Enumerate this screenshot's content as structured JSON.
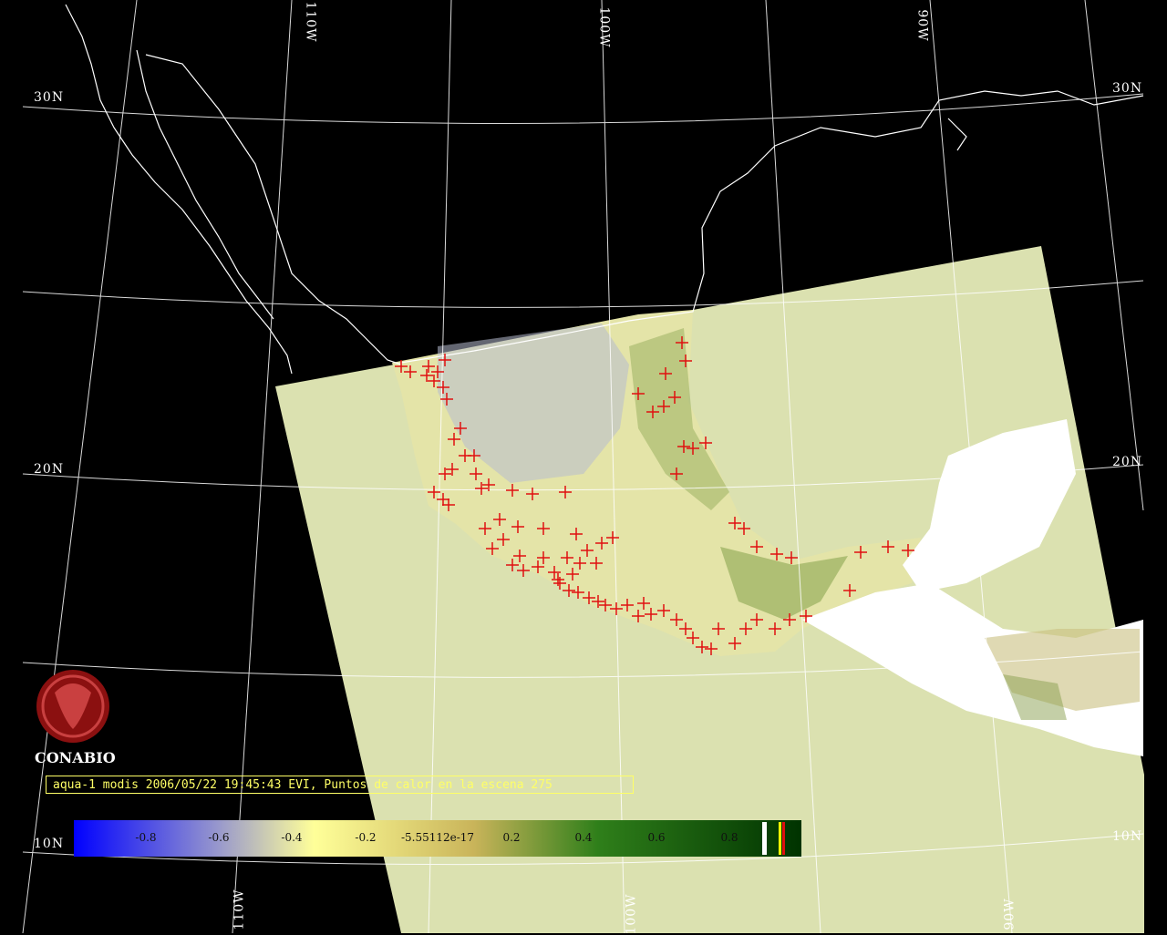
{
  "logo": {
    "org": "CONABIO"
  },
  "caption": {
    "text": "aqua-1 modis 2006/05/22 19:45:43 EVI, Puntos de calor en la escena 275"
  },
  "grid_labels": {
    "lat_30_left": "30N",
    "lat_30_right": "30N",
    "lat_20_left": "20N",
    "lat_20_right": "20N",
    "lat_10_left": "10N",
    "lat_10_right": "10N",
    "lon_110_top": "110W",
    "lon_100_top": "100W",
    "lon_90_top": "90W",
    "lon_110_bottom": "110W",
    "lon_100_bottom": "100W",
    "lon_90_bottom": "90W"
  },
  "colorbar": {
    "labels": [
      "-0.8",
      "-0.6",
      "-0.4",
      "-0.2",
      "-5.55112e-17",
      "0.2",
      "0.4",
      "0.6",
      "0.8"
    ],
    "colors": [
      "#0000ff",
      "#9999cc",
      "#ffff99",
      "#c9b45a",
      "#2f7f1a",
      "#003300"
    ]
  },
  "colors": {
    "scene_background": "#dbe1b0",
    "fire_marker": "#e01010",
    "coastline": "#ffffff",
    "graticule": "#ffffff",
    "caption": "#ffff66"
  }
}
